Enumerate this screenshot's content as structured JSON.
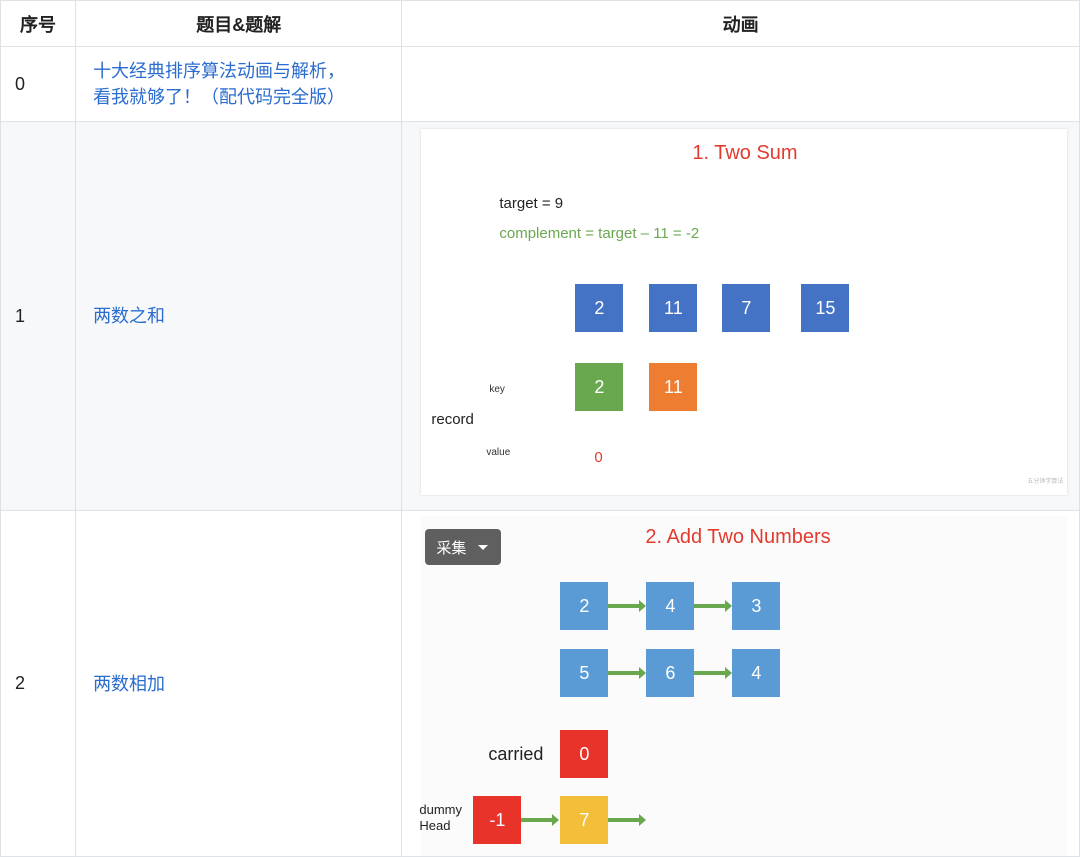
{
  "table": {
    "headers": [
      "序号",
      "题目&题解",
      "动画"
    ],
    "rows": [
      {
        "index": "0",
        "title_line1": "十大经典排序算法动画与解析，",
        "title_line2": "看我就够了！（配代码完全版）"
      },
      {
        "index": "1",
        "title": "两数之和"
      },
      {
        "index": "2",
        "title": "两数相加"
      }
    ]
  },
  "anim1": {
    "title": "1. Two Sum",
    "target_text": "target = 9",
    "complement_text": "complement = target – 11 = -2",
    "array": [
      "2",
      "11",
      "7",
      "15"
    ],
    "record_keys": [
      "2",
      "11"
    ],
    "record_values": [
      "0"
    ],
    "label_key": "key",
    "label_record": "record",
    "label_value": "value",
    "watermark": "五分钟学算法"
  },
  "anim2": {
    "title": "2. Add Two Numbers",
    "dropdown_label": "采集",
    "list1": [
      "2",
      "4",
      "3"
    ],
    "list2": [
      "5",
      "6",
      "4"
    ],
    "carried_label": "carried",
    "carried_value": "0",
    "dummy_label_line1": "dummy",
    "dummy_label_line2": "Head",
    "result": [
      "-1",
      "7"
    ]
  },
  "colors": {
    "link": "#2a6ccf",
    "title_red": "#e23b2e",
    "box_blue": "#4472c4",
    "box_green": "#6aa84f",
    "box_orange": "#ed7d31",
    "node_blue": "#5b9bd5",
    "node_red": "#e8332a",
    "node_yellow": "#f3bf3a"
  }
}
